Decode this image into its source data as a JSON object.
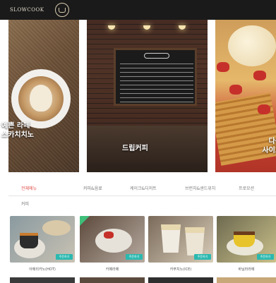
{
  "header": {
    "logo_text": "SLOWCOOK"
  },
  "banners": [
    {
      "caption_line1": "예쁜 라떼",
      "caption_line2": "스카치치노"
    },
    {
      "caption_line1": "",
      "caption_line2": "드립커피"
    },
    {
      "caption_line1": "다음",
      "caption_line2": "사이드"
    }
  ],
  "tabs": [
    "전체메뉴",
    "커피&음료",
    "케이크&디저트",
    "브런치&샌드위치",
    "프로모션"
  ],
  "subtab": "커피",
  "products": [
    {
      "name": "아메리카노(HOT)",
      "badge": "주문하기"
    },
    {
      "name": "카페라떼",
      "badge": "주문하기"
    },
    {
      "name": "카푸치노(ICE)",
      "badge": "주문하기"
    },
    {
      "name": "바닐라라떼",
      "badge": "주문하기"
    }
  ],
  "colors": {
    "active_tab": "#e0504a",
    "badge": "#2bb9b0",
    "topbar": "#1a1a1a"
  }
}
